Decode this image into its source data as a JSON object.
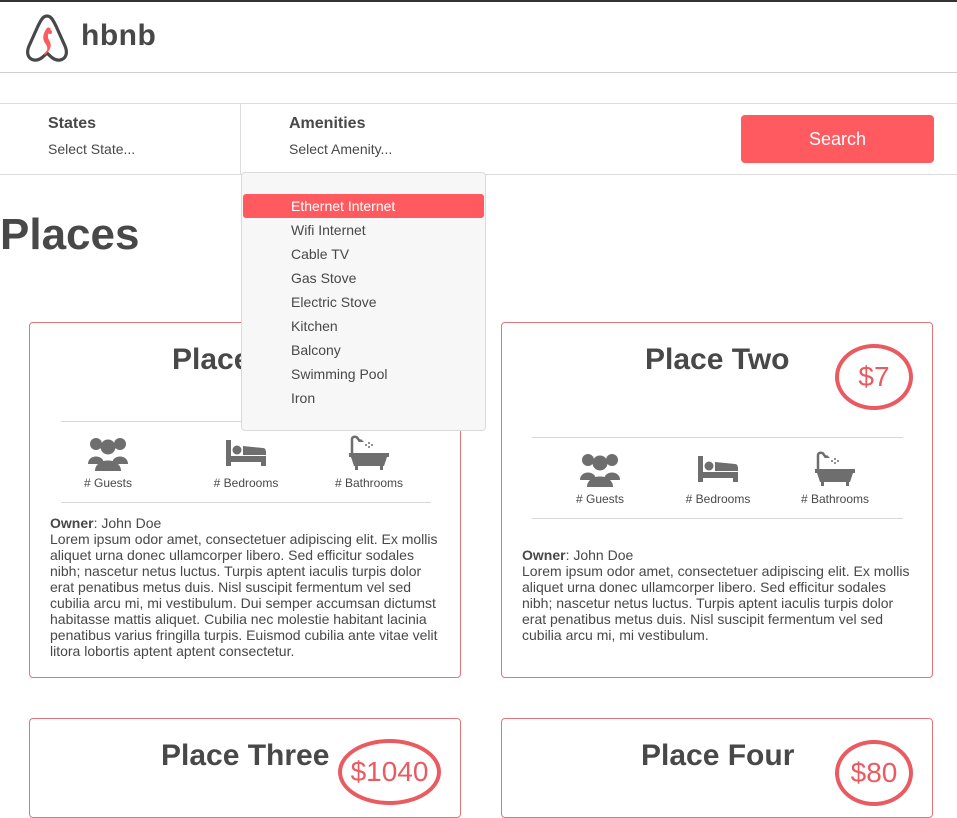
{
  "brand": {
    "name": "hbnb"
  },
  "filters": {
    "states": {
      "label": "States",
      "placeholder": "Select State..."
    },
    "amenities": {
      "label": "Amenities",
      "placeholder": "Select Amenity..."
    },
    "search_label": "Search"
  },
  "amenities_dropdown": {
    "items": [
      "Ethernet Internet",
      "Wifi Internet",
      "Cable TV",
      "Gas Stove",
      "Electric Stove",
      "Kitchen",
      "Balcony",
      "Swimming Pool",
      "Iron"
    ],
    "highlighted": "Ethernet Internet"
  },
  "places_title": "Places",
  "info_labels": {
    "guests": "# Guests",
    "bedrooms": "# Bedrooms",
    "bathrooms": "# Bathrooms"
  },
  "icons": {
    "guests": "group-icon",
    "bedrooms": "bed-icon",
    "bathrooms": "bathtub-icon",
    "logo": "airbnb-logo-icon"
  },
  "colors": {
    "accent": "#ff5a5f",
    "text": "#484848",
    "icon": "#6e6e6e"
  },
  "places": [
    {
      "name": "Place One",
      "price": "$",
      "owner_label": "Owner",
      "owner": ": John Doe",
      "description": "Lorem ipsum odor amet, consectetuer adipiscing elit. Ex mollis aliquet urna donec ullamcorper libero. Sed efficitur sodales nibh; nascetur netus luctus. Turpis aptent iaculis turpis dolor erat penatibus metus duis. Nisl suscipit fermentum vel sed cubilia arcu mi, mi vestibulum. Dui semper accumsan dictumst habitasse mattis aliquet. Cubilia nec molestie habitant lacinia penatibus varius fringilla turpis. Euismod cubilia ante vitae velit litora lobortis aptent aptent consectetur."
    },
    {
      "name": "Place Two",
      "price": "$7",
      "owner_label": "Owner",
      "owner": ": John Doe",
      "description": "Lorem ipsum odor amet, consectetuer adipiscing elit. Ex mollis aliquet urna donec ullamcorper libero. Sed efficitur sodales nibh; nascetur netus luctus. Turpis aptent iaculis turpis dolor erat penatibus metus duis. Nisl suscipit fermentum vel sed cubilia arcu mi, mi vestibulum."
    },
    {
      "name": "Place Three",
      "price": "$1040"
    },
    {
      "name": "Place Four",
      "price": "$80"
    }
  ]
}
